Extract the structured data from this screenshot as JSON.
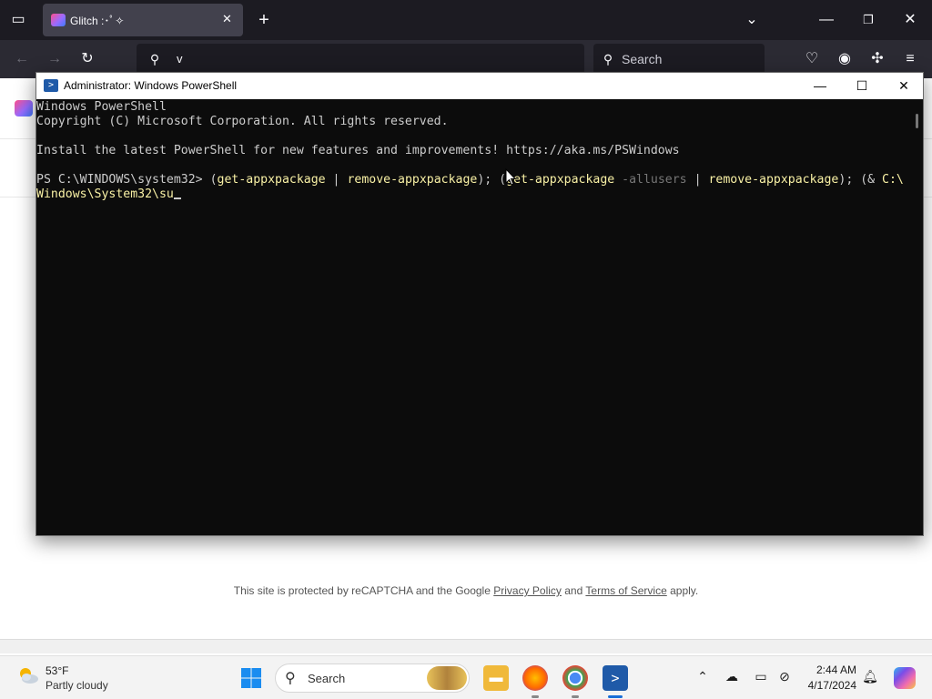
{
  "browser": {
    "tab_title": "Glitch :･ﾟ✧",
    "url_text": "v",
    "search_placeholder": "Search"
  },
  "page": {
    "recaptcha_prefix": "This site is protected by reCAPTCHA and the Google ",
    "privacy_link": "Privacy Policy",
    "and_text": " and ",
    "terms_link": "Terms of Service",
    "suffix": " apply."
  },
  "powershell": {
    "window_title": "Administrator: Windows PowerShell",
    "lines": {
      "l1": "Windows PowerShell",
      "l2": "Copyright (C) Microsoft Corporation. All rights reserved.",
      "l3": "Install the latest PowerShell for new features and improvements! https://aka.ms/PSWindows",
      "prompt": "PS C:\\WINDOWS\\system32> ",
      "seg1a": "(",
      "seg1b": "get-appxpackage",
      "seg1c": " | ",
      "seg1d": "remove-appxpackage",
      "seg1e": "); (",
      "seg2a": "get-appxpackage",
      "seg2b": " -allusers",
      "seg2c": " | ",
      "seg2d": "remove-appxpackage",
      "seg2e": "); (& ",
      "seg2f": "C:\\",
      "l5": "Windows\\System32\\su"
    }
  },
  "taskbar": {
    "weather_temp": "53°F",
    "weather_desc": "Partly cloudy",
    "search_label": "Search",
    "time": "2:44 AM",
    "date": "4/17/2024"
  },
  "colors": {
    "console_bg": "#0c0c0c",
    "console_text": "#cccccc",
    "command_yellow": "#f9f1a5",
    "param_gray": "#767676",
    "browser_dark": "#1c1b22"
  }
}
